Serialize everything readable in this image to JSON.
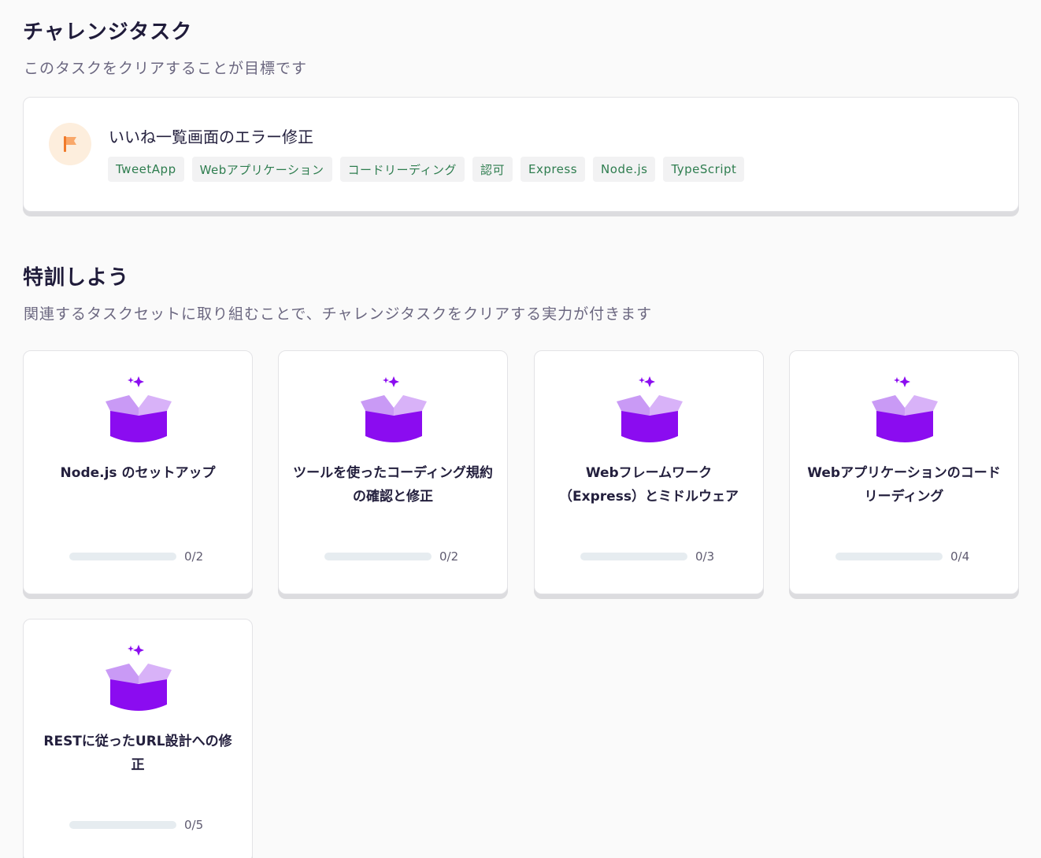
{
  "challenge": {
    "title": "チャレンジタスク",
    "subtitle": "このタスクをクリアすることが目標です",
    "task": {
      "name": "いいね一覧画面のエラー修正",
      "icon": "flag-icon",
      "tags": [
        "TweetApp",
        "Webアプリケーション",
        "コードリーディング",
        "認可",
        "Express",
        "Node.js",
        "TypeScript"
      ]
    }
  },
  "training": {
    "title": "特訓しよう",
    "subtitle": "関連するタスクセットに取り組むことで、チャレンジタスクをクリアする実力が付きます",
    "tasksets": [
      {
        "title": "Node.js のセットアップ",
        "progress": "0/2",
        "completed": 0,
        "total": 2,
        "icon": "gift-box-icon"
      },
      {
        "title": "ツールを使ったコーディング規約の確認と修正",
        "progress": "0/2",
        "completed": 0,
        "total": 2,
        "icon": "gift-box-icon"
      },
      {
        "title": "Webフレームワーク（Express）とミドルウェア",
        "progress": "0/3",
        "completed": 0,
        "total": 3,
        "icon": "gift-box-icon"
      },
      {
        "title": "Webアプリケーションのコードリーディング",
        "progress": "0/4",
        "completed": 0,
        "total": 4,
        "icon": "gift-box-icon"
      },
      {
        "title": "RESTに従ったURL設計への修正",
        "progress": "0/5",
        "completed": 0,
        "total": 5,
        "icon": "gift-box-icon"
      }
    ]
  },
  "colors": {
    "tag_text": "#2e7d4f",
    "box_purple": "#8b0cf0",
    "box_lid": "#c99af5",
    "flag_orange": "#f08a3c"
  }
}
